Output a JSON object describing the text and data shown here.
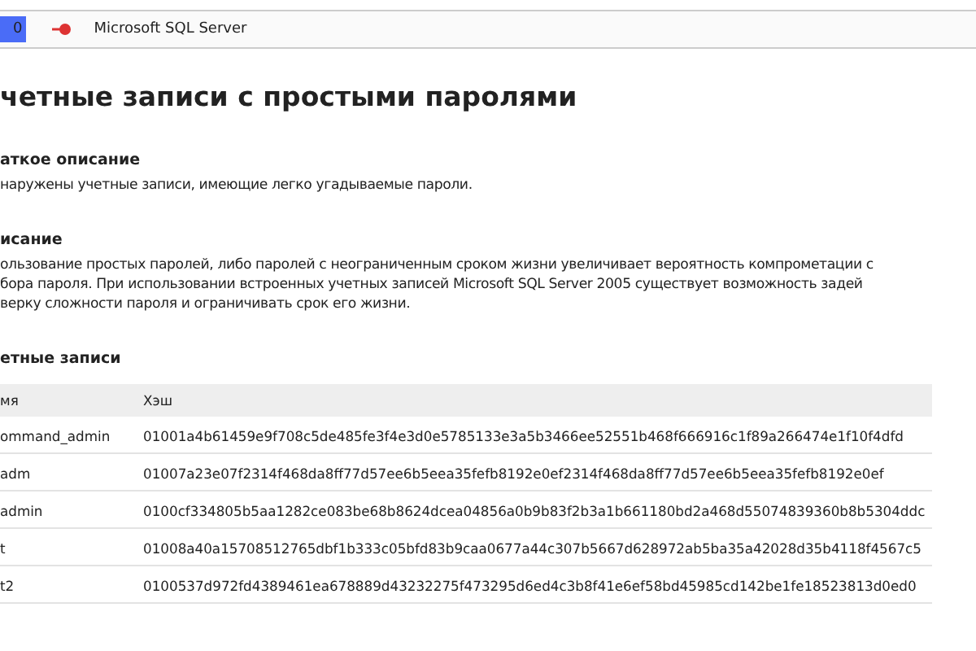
{
  "toolbar": {
    "tab_label": "0",
    "server": "Microsoft SQL Server"
  },
  "title": "четные записи с простыми паролями",
  "sections": [
    {
      "heading": "аткое описание",
      "lines": [
        "наружены учетные записи, имеющие легко угадываемые пароли."
      ]
    },
    {
      "heading": "исание",
      "lines": [
        "ользование простых паролей, либо паролей с неограниченным сроком жизни увеличивает вероятность компрометации с",
        "бора пароля. При использовании встроенных учетных записей Microsoft SQL Server 2005 существует возможность задей",
        "верку сложности пароля и ограничивать срок его жизни."
      ]
    }
  ],
  "accounts": {
    "heading": "етные записи",
    "columns": [
      "мя",
      "Хэш"
    ],
    "rows": [
      [
        "ommand_admin",
        "01001a4b61459e9f708c5de485fe3f4e3d0e5785133e3a5b3466ee52551b468f666916c1f89a266474e1f10f4dfd"
      ],
      [
        "adm",
        "01007a23e07f2314f468da8ff77d57ee6b5eea35fefb8192e0ef2314f468da8ff77d57ee6b5eea35fefb8192e0ef"
      ],
      [
        "admin",
        "0100cf334805b5aa1282ce083be68b8624dcea04856a0b9b83f2b3a1b661180bd2a468d55074839360b8b5304ddc"
      ],
      [
        "t",
        "01008a40a15708512765dbf1b333c05bfd83b9caa0677a44c307b5667d628972ab5ba35a42028d35b4118f4567c5"
      ],
      [
        "t2",
        "0100537d972fd4389461ea678889d43232275f473295d6ed4c3b8f41e6ef58bd45985cd142be1fe18523813d0ed0"
      ]
    ]
  }
}
